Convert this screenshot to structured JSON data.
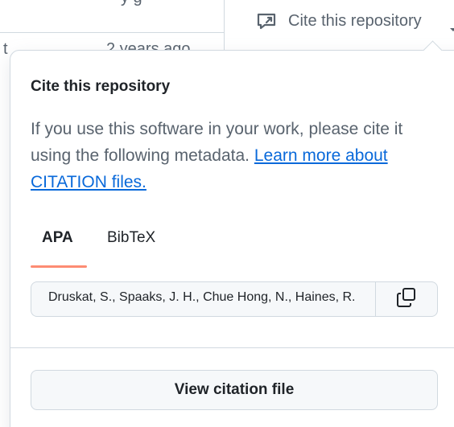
{
  "background": {
    "top_fragment": "y  g",
    "row2_left": "t",
    "row2_right": "2 years ago"
  },
  "trigger": {
    "label": "Cite this repository",
    "icon": "cite-icon"
  },
  "popover": {
    "title": "Cite this repository",
    "description": "If you use this software in your work, please cite it using the following metadata.",
    "link_text": "Learn more about CITATION files.",
    "tabs": [
      {
        "label": "APA",
        "selected": true
      },
      {
        "label": "BibTeX",
        "selected": false
      }
    ],
    "citation_text": "Druskat, S., Spaaks, J. H., Chue Hong, N., Haines, R.",
    "copy_icon": "copy-icon",
    "view_button": "View citation file"
  },
  "colors": {
    "accent_underline": "#fd8c73",
    "link": "#0969da",
    "muted_text": "#59636e",
    "border": "#d1d9e0"
  }
}
